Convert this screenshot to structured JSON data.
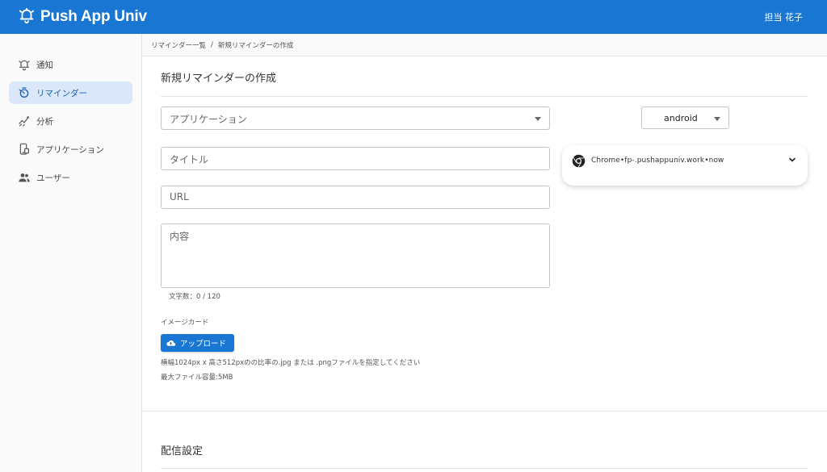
{
  "app": {
    "title": "Push App Univ",
    "user_name": "担当 花子"
  },
  "sidebar": {
    "items": [
      {
        "label": "通知",
        "icon": "bell-icon",
        "active": false
      },
      {
        "label": "リマインダー",
        "icon": "timer-icon",
        "active": true
      },
      {
        "label": "分析",
        "icon": "analytics-icon",
        "active": false
      },
      {
        "label": "アプリケーション",
        "icon": "app-icon",
        "active": false
      },
      {
        "label": "ユーザー",
        "icon": "users-icon",
        "active": false
      }
    ]
  },
  "breadcrumb": {
    "parent": "リマインダー一覧",
    "separator": "/",
    "current": "新規リマインダーの作成"
  },
  "form": {
    "title": "新規リマインダーの作成",
    "application_placeholder": "アプリケーション",
    "title_placeholder": "タイトル",
    "url_placeholder": "URL",
    "content_placeholder": "内容",
    "char_count": "文字数：0 / 120",
    "image_label": "イメージカード",
    "upload_label": "アップロード",
    "note_line1": "横幅1024px x 高さ512pxのの比率の.jpg または .pngファイルを指定してください",
    "note_line2": "最大ファイル容量:5MB"
  },
  "preview": {
    "os_value": "android",
    "notification_text": "Chrome•fp-.pushappuniv.work•now"
  },
  "delivery": {
    "title": "配信設定"
  },
  "colors": {
    "primary": "#1976d2",
    "active_bg": "#dbe8fb"
  }
}
